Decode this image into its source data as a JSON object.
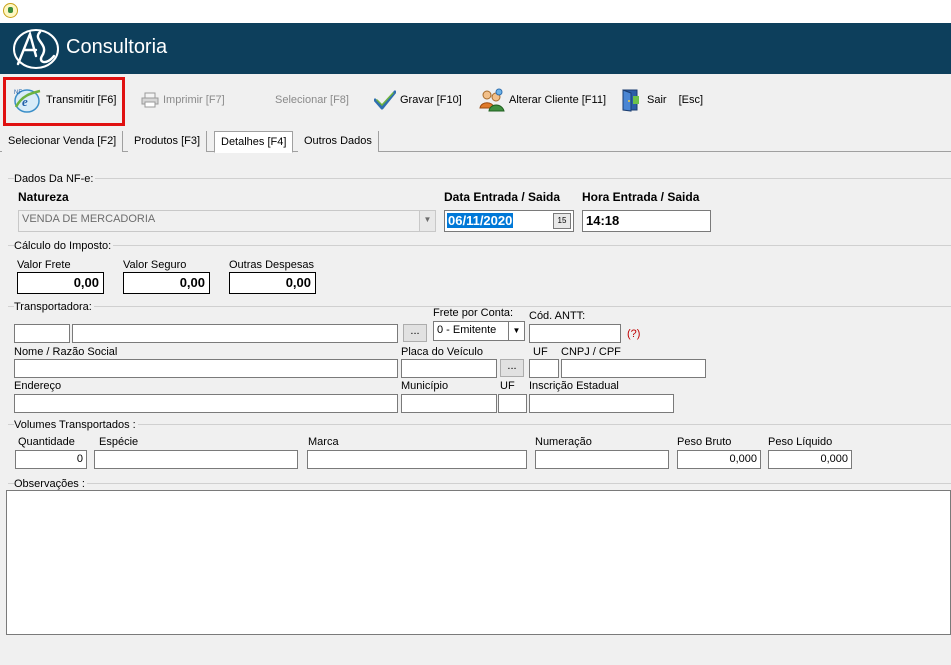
{
  "brand": {
    "name": "Consultoria"
  },
  "toolbar": {
    "transmitir": "Transmitir [F6]",
    "imprimir": "Imprimir  [F7]",
    "selecionar": "Selecionar [F8]",
    "gravar": "Gravar [F10]",
    "alterar_cliente": "Alterar Cliente [F11]",
    "sair": "Sair",
    "sair_key": "[Esc]"
  },
  "tabs": [
    "Selecionar Venda [F2]",
    "Produtos [F3]",
    "Detalhes [F4]",
    "Outros Dados"
  ],
  "nfe": {
    "group_label": "Dados Da NF-e:",
    "natureza_label": "Natureza",
    "natureza_value": "VENDA DE MERCADORIA",
    "data_label": "Data Entrada / Saida",
    "data_value": "06/11/2020",
    "hora_label": "Hora Entrada / Saida",
    "hora_value": "14:18"
  },
  "imposto": {
    "group_label": "Cálculo do Imposto:",
    "frete_label": "Valor Frete",
    "frete_value": "0,00",
    "seguro_label": "Valor Seguro",
    "seguro_value": "0,00",
    "despesas_label": "Outras Despesas",
    "despesas_value": "0,00"
  },
  "transportadora": {
    "group_label": "Transportadora:",
    "btn_dots": "...",
    "frete_conta_label": "Frete por Conta:",
    "frete_conta_value": "0 - Emitente",
    "antt_label": "Cód. ANTT:",
    "antt_help": "(?)",
    "nome_label": "Nome / Razão Social",
    "placa_label": "Placa do Veículo",
    "uf_label": "UF",
    "cnpj_label": "CNPJ / CPF",
    "endereco_label": "Endereço",
    "municipio_label": "Município",
    "uf2_label": "UF",
    "ie_label": "Inscrição Estadual"
  },
  "volumes": {
    "group_label": "Volumes Transportados :",
    "quantidade_label": "Quantidade",
    "quantidade_value": "0",
    "especie_label": "Espécie",
    "marca_label": "Marca",
    "numeracao_label": "Numeração",
    "peso_bruto_label": "Peso Bruto",
    "peso_bruto_value": "0,000",
    "peso_liquido_label": "Peso Líquido",
    "peso_liquido_value": "0,000"
  },
  "observacoes": {
    "group_label": "Observações :"
  },
  "colors": {
    "banner": "#0d3f5c",
    "highlight": "#e01010",
    "selection": "#0078d7"
  }
}
